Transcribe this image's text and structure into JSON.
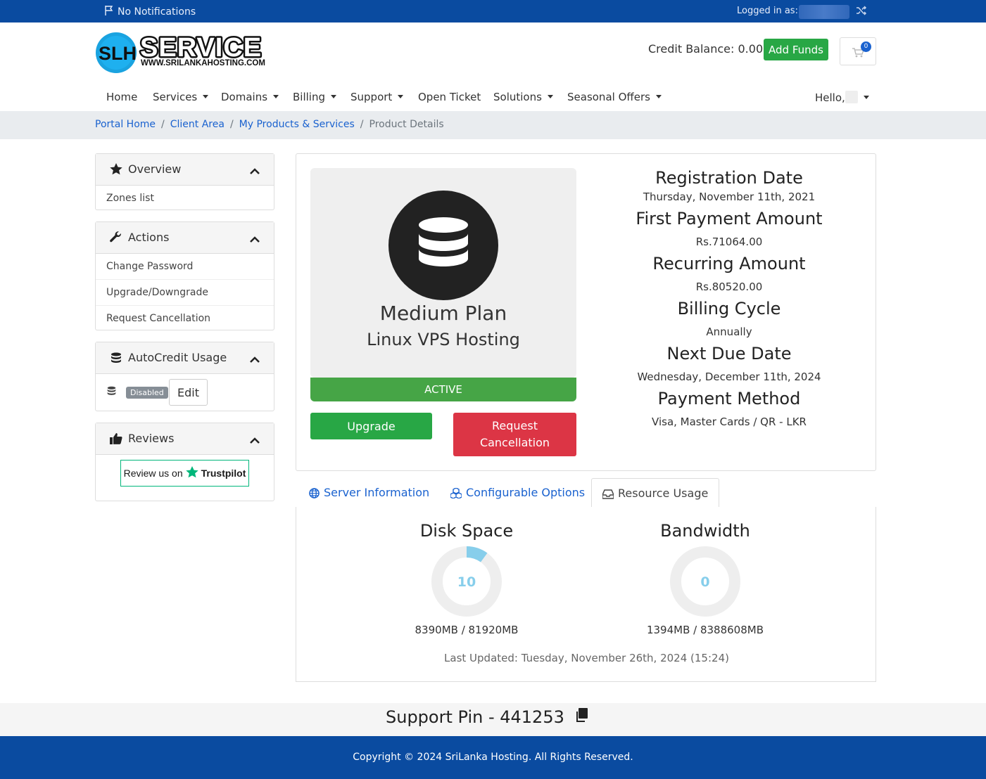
{
  "topbar": {
    "notifications": "No Notifications",
    "logged_in_label": "Logged in as:"
  },
  "header": {
    "logo_text": "SERVICE",
    "logo_url_text": "WWW.SRILANKAHOSTING.COM",
    "logo_mark": "SLH",
    "credit_balance": "Credit Balance: 0.00",
    "add_funds": "Add Funds",
    "cart_count": "0"
  },
  "nav": {
    "items": [
      {
        "label": "Home"
      },
      {
        "label": "Services"
      },
      {
        "label": "Domains"
      },
      {
        "label": "Billing"
      },
      {
        "label": "Support"
      },
      {
        "label": "Open Ticket"
      },
      {
        "label": "Solutions"
      },
      {
        "label": "Seasonal Offers"
      }
    ],
    "hello": "Hello,"
  },
  "breadcrumb": {
    "items": [
      "Portal Home",
      "Client Area",
      "My Products & Services",
      "Product Details"
    ]
  },
  "sidebar": {
    "overview": {
      "title": "Overview",
      "links": [
        "Zones list"
      ]
    },
    "actions": {
      "title": "Actions",
      "links": [
        "Change Password",
        "Upgrade/Downgrade",
        "Request Cancellation"
      ]
    },
    "autocredit": {
      "title": "AutoCredit Usage",
      "status": "Disabled",
      "edit": "Edit"
    },
    "reviews": {
      "title": "Reviews",
      "review_text": "Review us on",
      "trustpilot": "Trustpilot"
    }
  },
  "product": {
    "plan": "Medium Plan",
    "group": "Linux VPS Hosting",
    "status": "ACTIVE",
    "upgrade": "Upgrade",
    "cancel": "Request Cancellation",
    "details": [
      {
        "label": "Registration Date",
        "value": "Thursday, November 11th, 2021"
      },
      {
        "label": "First Payment Amount",
        "value": "Rs.71064.00"
      },
      {
        "label": "Recurring Amount",
        "value": "Rs.80520.00"
      },
      {
        "label": "Billing Cycle",
        "value": "Annually"
      },
      {
        "label": "Next Due Date",
        "value": "Wednesday, December 11th, 2024"
      },
      {
        "label": "Payment Method",
        "value": "Visa, Master Cards / QR - LKR"
      }
    ]
  },
  "tabs": {
    "server_info": "Server Information",
    "config_options": "Configurable Options",
    "resource_usage": "Resource Usage"
  },
  "usage": {
    "disk": {
      "title": "Disk Space",
      "percent": "10",
      "stats": "8390MB / 81920MB",
      "fraction": 0.1
    },
    "bandwidth": {
      "title": "Bandwidth",
      "percent": "0",
      "stats": "1394MB / 8388608MB",
      "fraction": 0.0
    },
    "last_updated": "Last Updated: Tuesday, November 26th, 2024 (15:24)"
  },
  "support_pin": "Support Pin - 441253",
  "footer": "Copyright © 2024 SriLanka Hosting. All Rights Reserved.",
  "colors": {
    "brand_blue": "#0a4ba0",
    "success": "#28a745",
    "danger": "#dc3545",
    "gauge": "#87ceeb"
  }
}
